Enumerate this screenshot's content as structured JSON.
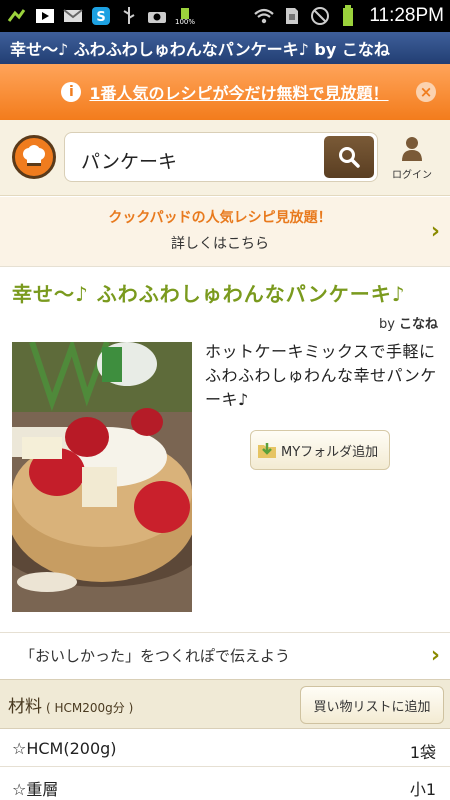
{
  "status_bar": {
    "time": "11:28PM",
    "battery_percent": "100%",
    "icons": [
      "missed-call-icon",
      "media-play-icon",
      "gmail-icon",
      "skype-icon",
      "usb-icon",
      "camera-icon",
      "battery-icon",
      "wifi-icon",
      "sim-icon",
      "no-signal-icon",
      "charging-icon"
    ]
  },
  "title_bar": {
    "title": "幸せ〜♪ ふわふわしゅわんなパンケーキ♪ by こなね"
  },
  "promo": {
    "text": "1番人気のレシピが今だけ無料で見放題！",
    "info_glyph": "i",
    "close_glyph": "×"
  },
  "header": {
    "search_value": "パンケーキ",
    "login_label": "ログイン"
  },
  "popular": {
    "line1": "クックパッドの人気レシピ見放題！",
    "line2": "詳しくはこちら"
  },
  "recipe": {
    "title": "幸せ〜♪ ふわふわしゅわんなパンケーキ♪",
    "by_label": "by",
    "author": "こなね",
    "description": "ホットケーキミックスで手軽にふわふわしゅわんな幸せパンケーキ♪",
    "folder_button": "MYフォルダ追加"
  },
  "report": {
    "text": "「おいしかった」をつくれぽで伝えよう"
  },
  "ingredients": {
    "title": "材料",
    "servings": "( HCM200g分 )",
    "shopping_button": "買い物リストに追加",
    "items": [
      {
        "name": "☆HCM(200g)",
        "qty": "1袋"
      },
      {
        "name": "☆重層",
        "qty": "小1"
      }
    ]
  },
  "colors": {
    "title_bar": "#2e4f88",
    "promo": "#f58a2e",
    "accent_green": "#7a9a1e",
    "accent_orange": "#e87a1e",
    "search_button": "#6a4c2c"
  }
}
